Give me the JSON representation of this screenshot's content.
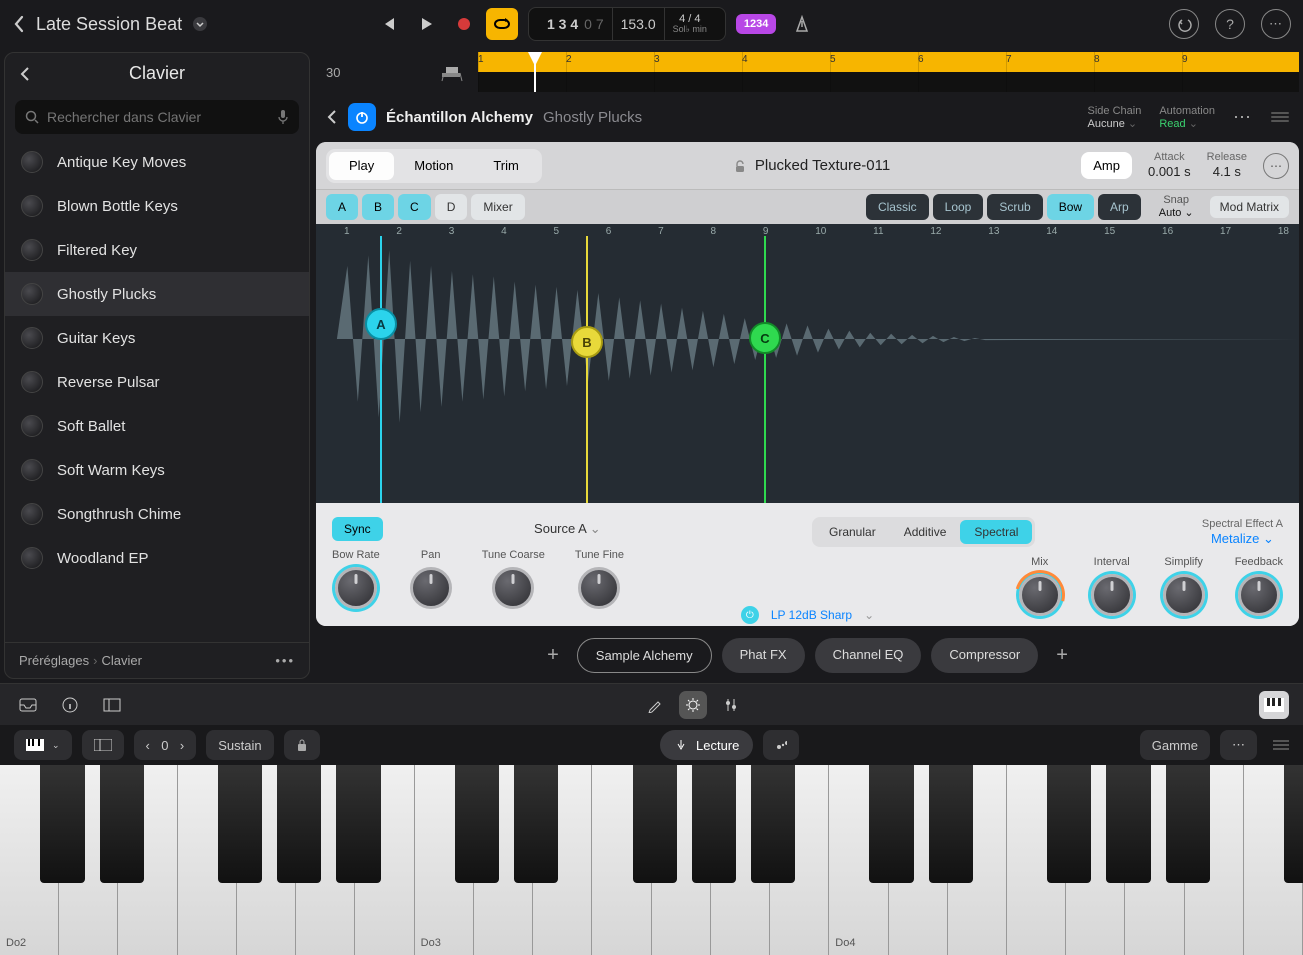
{
  "project_title": "Late Session Beat",
  "lcd": {
    "position": "1 3 4",
    "bars": "0 7",
    "tempo": "153.0",
    "sig": "4 / 4",
    "key": "Sol♭ min"
  },
  "count_in": "1234",
  "sidebar": {
    "title": "Clavier",
    "search_placeholder": "Rechercher dans Clavier",
    "items": [
      "Antique Key Moves",
      "Blown Bottle Keys",
      "Filtered Key",
      "Ghostly Plucks",
      "Guitar Keys",
      "Reverse Pulsar",
      "Soft Ballet",
      "Soft Warm Keys",
      "Songthrush Chime",
      "Woodland EP"
    ],
    "selected_index": 3,
    "breadcrumb_a": "Préréglages",
    "breadcrumb_b": "Clavier"
  },
  "ruler": {
    "head": "30",
    "ticks": [
      "1",
      "2",
      "3",
      "4",
      "5",
      "6",
      "7",
      "8",
      "9"
    ]
  },
  "plugin": {
    "title": "Échantillon Alchemy",
    "preset": "Ghostly Plucks",
    "sidechain_lbl": "Side Chain",
    "sidechain_val": "Aucune",
    "automation_lbl": "Automation",
    "automation_val": "Read",
    "seg": [
      "Play",
      "Motion",
      "Trim"
    ],
    "seg_active": 0,
    "sample_name": "Plucked Texture-011",
    "amp": "Amp",
    "attack_lbl": "Attack",
    "attack_val": "0.001 s",
    "release_lbl": "Release",
    "release_val": "4.1 s",
    "abc": [
      "A",
      "B",
      "C",
      "D",
      "Mixer"
    ],
    "abc_on": [
      true,
      true,
      true,
      false,
      false
    ],
    "modes": [
      "Classic",
      "Loop",
      "Scrub",
      "Bow",
      "Arp"
    ],
    "mode_on_index": 3,
    "snap_lbl": "Snap",
    "snap_val": "Auto",
    "modmatrix": "Mod Matrix",
    "wave_ticks": [
      "1",
      "2",
      "3",
      "4",
      "5",
      "6",
      "7",
      "8",
      "9",
      "10",
      "11",
      "12",
      "13",
      "14",
      "15",
      "16",
      "17",
      "18"
    ],
    "sync": "Sync",
    "source": "Source A",
    "knobs_left": [
      "Bow Rate",
      "Pan",
      "Tune Coarse",
      "Tune Fine"
    ],
    "gran_seg": [
      "Granular",
      "Additive",
      "Spectral"
    ],
    "gran_on": 2,
    "spec_lbl": "Spectral Effect A",
    "spec_val": "Metalize",
    "knobs_right": [
      "Mix",
      "Interval",
      "Simplify",
      "Feedback"
    ],
    "filter_name": "LP 12dB Sharp"
  },
  "fx_tabs": [
    "Sample Alchemy",
    "Phat FX",
    "Channel EQ",
    "Compressor"
  ],
  "fx_active": 0,
  "lower2": {
    "octave": "0",
    "sustain": "Sustain",
    "lecture": "Lecture",
    "gamme": "Gamme"
  },
  "piano_labels": [
    "Do2",
    "Do3",
    "Do4"
  ]
}
